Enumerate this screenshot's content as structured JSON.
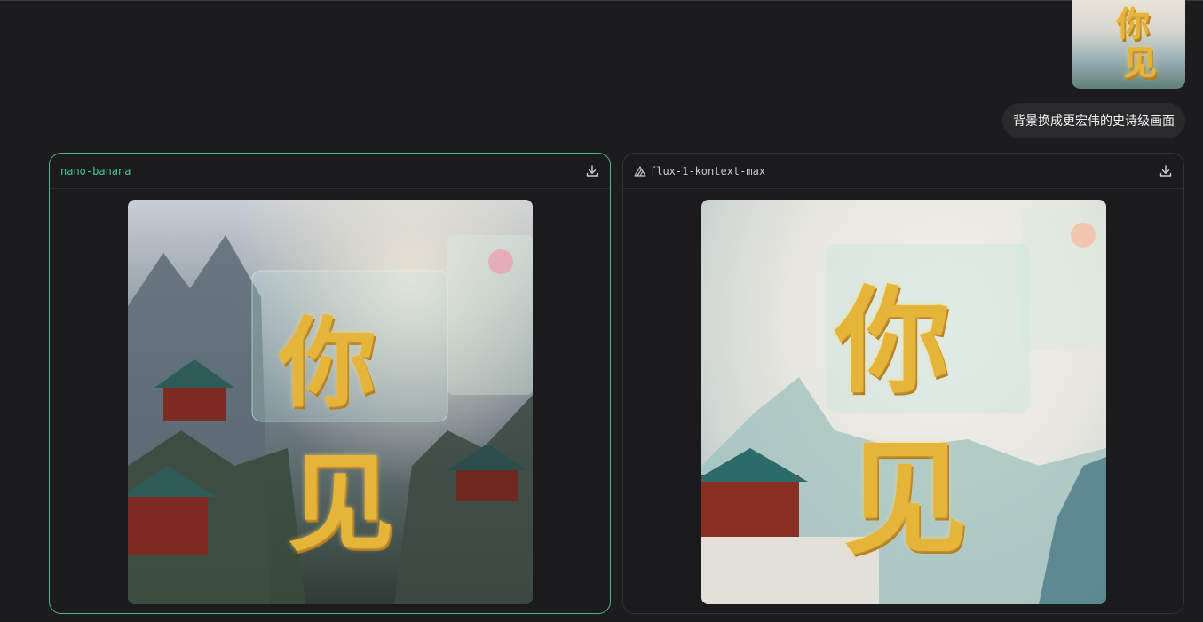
{
  "conversation": {
    "user_message": "背景换成更宏伟的史诗级画面",
    "user_image_icon": "uploaded-image-thumbnail"
  },
  "results": [
    {
      "model": "nano-banana",
      "selected": true,
      "download_icon": "download-icon",
      "image_icon": "generated-image"
    },
    {
      "model": "flux-1-kontext-max",
      "selected": false,
      "vendor_icon": "flux-logo-icon",
      "download_icon": "download-icon",
      "image_icon": "generated-image"
    }
  ],
  "colors": {
    "background": "#1c1c1e",
    "selected_border": "#4bb78a",
    "selected_model_text": "#4bc48f",
    "card_border": "#333336"
  },
  "image_text": {
    "glyph_1": "你",
    "glyph_2": "见"
  }
}
